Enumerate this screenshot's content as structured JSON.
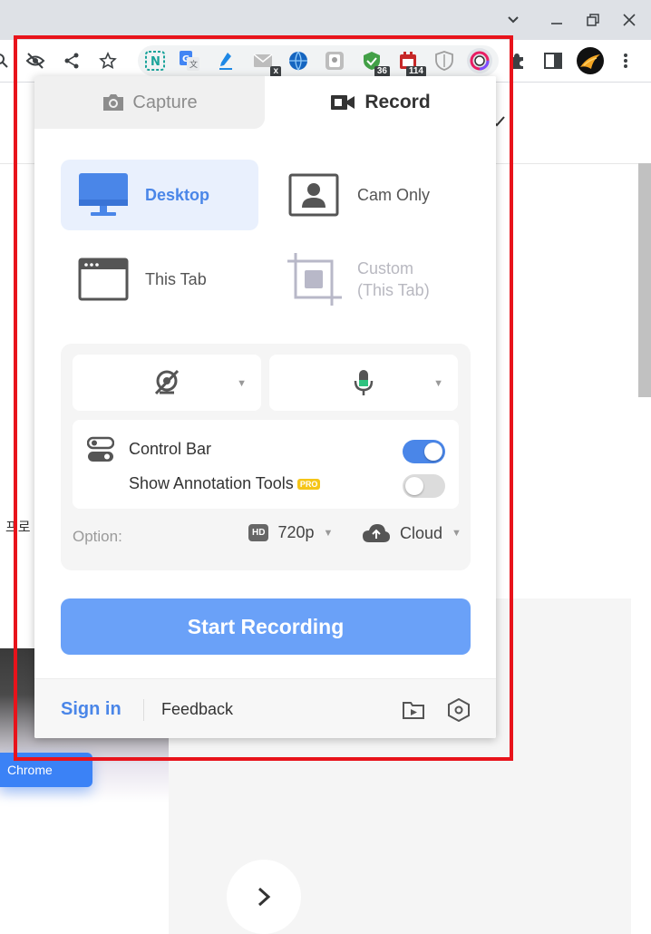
{
  "browser": {
    "window_controls": [
      "chevron-down",
      "minimize",
      "restore",
      "close"
    ],
    "extension_badges": {
      "ext_x": "x",
      "ext_shield_green": "36",
      "ext_calendar": "114"
    }
  },
  "page": {
    "side_text": "프로",
    "chrome_button": "Chrome"
  },
  "popup": {
    "tabs": {
      "capture": "Capture",
      "record": "Record"
    },
    "modes": {
      "desktop": "Desktop",
      "cam_only": "Cam Only",
      "this_tab": "This Tab",
      "custom_line1": "Custom",
      "custom_line2": "(This Tab)"
    },
    "toggles": {
      "control_bar": "Control Bar",
      "control_bar_on": true,
      "annotation": "Show Annotation Tools",
      "annotation_on": false,
      "pro_badge": "PRO"
    },
    "options": {
      "label": "Option:",
      "quality_badge": "HD",
      "quality": "720p",
      "storage": "Cloud"
    },
    "start_button": "Start Recording",
    "footer": {
      "sign_in": "Sign in",
      "feedback": "Feedback"
    }
  },
  "colors": {
    "accent": "#4a86e8",
    "start_button": "#6aa1f8",
    "toggle_on": "#4a86e8",
    "highlight_frame": "#e8131b"
  }
}
